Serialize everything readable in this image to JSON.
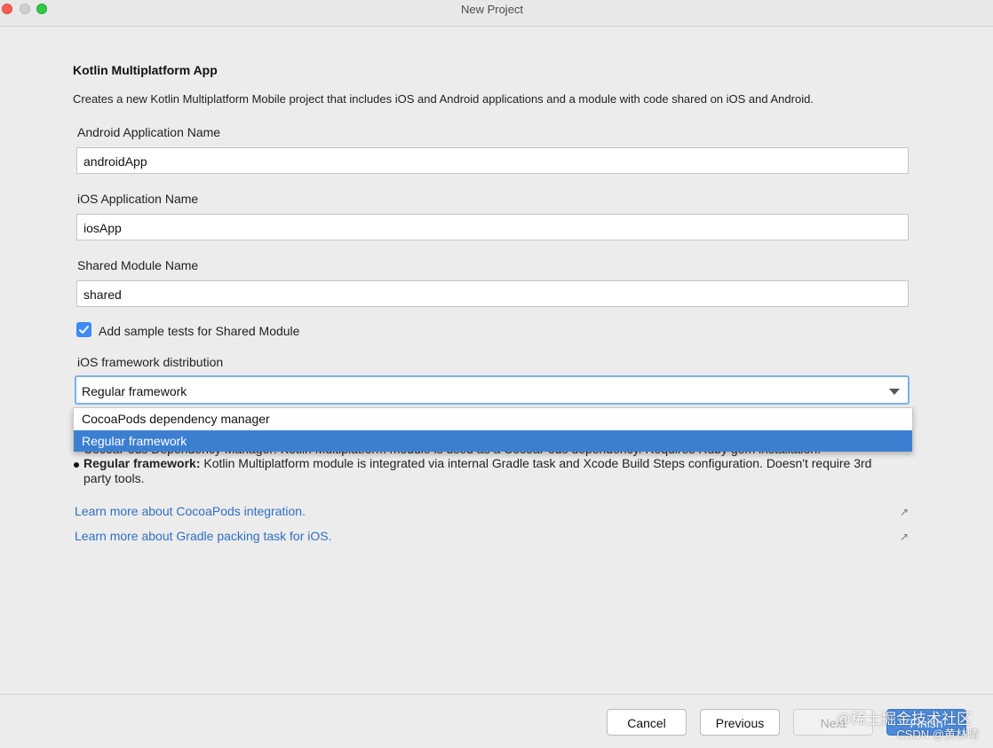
{
  "window": {
    "title": "New Project"
  },
  "heading": "Kotlin Multiplatform App",
  "description": "Creates a new Kotlin Multiplatform Mobile project that includes iOS and Android applications and a module with code shared on iOS and Android.",
  "fields": {
    "android_app_name": {
      "label": "Android Application Name",
      "value": "androidApp"
    },
    "ios_app_name": {
      "label": "iOS Application Name",
      "value": "iosApp"
    },
    "shared_module_name": {
      "label": "Shared Module Name",
      "value": "shared"
    }
  },
  "sample_tests": {
    "label": "Add sample tests for Shared Module",
    "checked": true
  },
  "distribution": {
    "label": "iOS framework distribution",
    "selected": "Regular framework",
    "options": [
      "CocoaPods dependency manager",
      "Regular framework"
    ]
  },
  "bullets": {
    "partially_hidden": "CocoaPods Dependency Manager: Kotlin Multiplatform module is used as a CocoaPods dependency. Requires Ruby gem installation.",
    "regular_title": "Regular framework:",
    "regular_text": " Kotlin Multiplatform module is integrated via internal Gradle task and Xcode Build Steps configuration. Doesn't require 3rd party tools."
  },
  "links": {
    "cocoapods": "Learn more about CocoaPods integration.",
    "gradle": "Learn more about Gradle packing task for iOS."
  },
  "buttons": {
    "cancel": "Cancel",
    "previous": "Previous",
    "next": "Next",
    "finish": "Finish"
  },
  "watermark": {
    "line1": "@稀土掘金技术社区",
    "line2": "CSDN @黄林晴"
  }
}
